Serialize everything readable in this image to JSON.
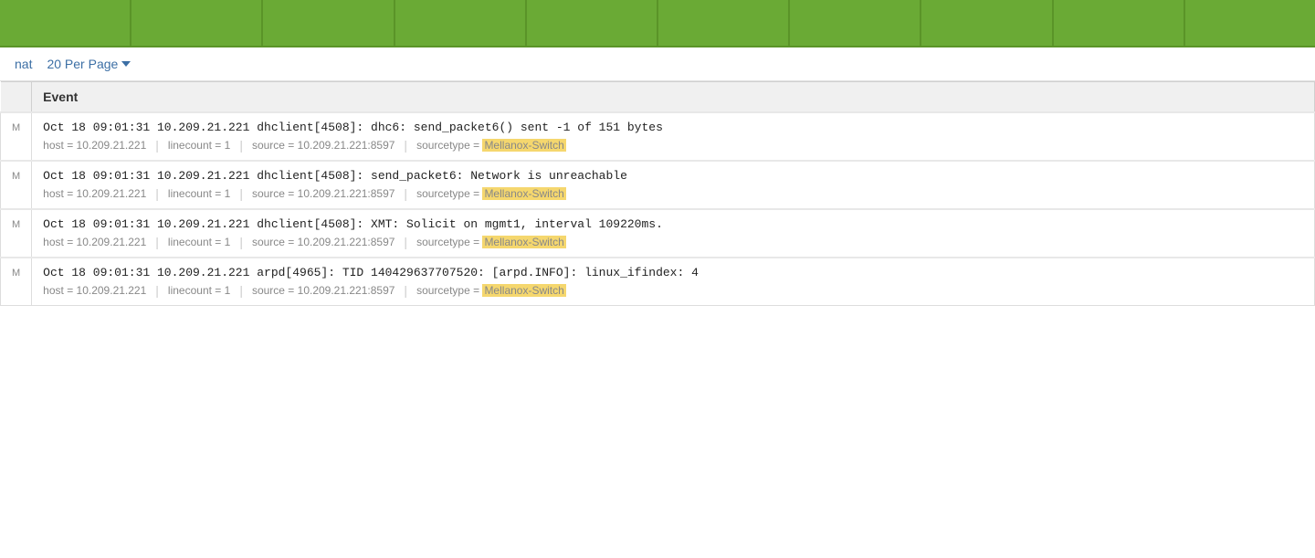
{
  "header": {
    "cols": [
      "",
      "",
      "",
      "",
      "",
      "",
      "",
      "",
      "",
      ""
    ]
  },
  "toolbar": {
    "format_label": "nat",
    "per_page_label": "20 Per Page",
    "chevron": "▾"
  },
  "table": {
    "column_header": "Event",
    "rows": [
      {
        "id": 1,
        "prefix": "",
        "main_text": "Oct 18 09:01:31 10.209.21.221 dhclient[4508]: dhc6: send_packet6() sent -1 of 151 bytes",
        "meta_host": "host = 10.209.21.221",
        "meta_linecount": "linecount = 1",
        "meta_source": "source = 10.209.21.221:8597",
        "meta_sourcetype_label": "sourcetype = ",
        "meta_sourcetype_value": "Mellanox-Switch",
        "left_label": "M"
      },
      {
        "id": 2,
        "prefix": "",
        "main_text": "Oct 18 09:01:31 10.209.21.221 dhclient[4508]: send_packet6: Network is unreachable",
        "meta_host": "host = 10.209.21.221",
        "meta_linecount": "linecount = 1",
        "meta_source": "source = 10.209.21.221:8597",
        "meta_sourcetype_label": "sourcetype = ",
        "meta_sourcetype_value": "Mellanox-Switch",
        "left_label": "M"
      },
      {
        "id": 3,
        "prefix": "",
        "main_text": "Oct 18 09:01:31 10.209.21.221 dhclient[4508]: XMT: Solicit on mgmt1, interval 109220ms.",
        "meta_host": "host = 10.209.21.221",
        "meta_linecount": "linecount = 1",
        "meta_source": "source = 10.209.21.221:8597",
        "meta_sourcetype_label": "sourcetype = ",
        "meta_sourcetype_value": "Mellanox-Switch",
        "left_label": "M"
      },
      {
        "id": 4,
        "prefix": "",
        "main_text": "Oct 18 09:01:31 10.209.21.221 arpd[4965]: TID 140429637707520: [arpd.INFO]: linux_ifindex: 4",
        "meta_host": "host = 10.209.21.221",
        "meta_linecount": "linecount = 1",
        "meta_source": "source = 10.209.21.221:8597",
        "meta_sourcetype_label": "sourcetype = ",
        "meta_sourcetype_value": "Mellanox-Switch",
        "left_label": "M"
      }
    ]
  },
  "colors": {
    "green_header": "#6aaa35",
    "highlight_bg": "#f5d76e",
    "link_blue": "#3c6fa5"
  }
}
